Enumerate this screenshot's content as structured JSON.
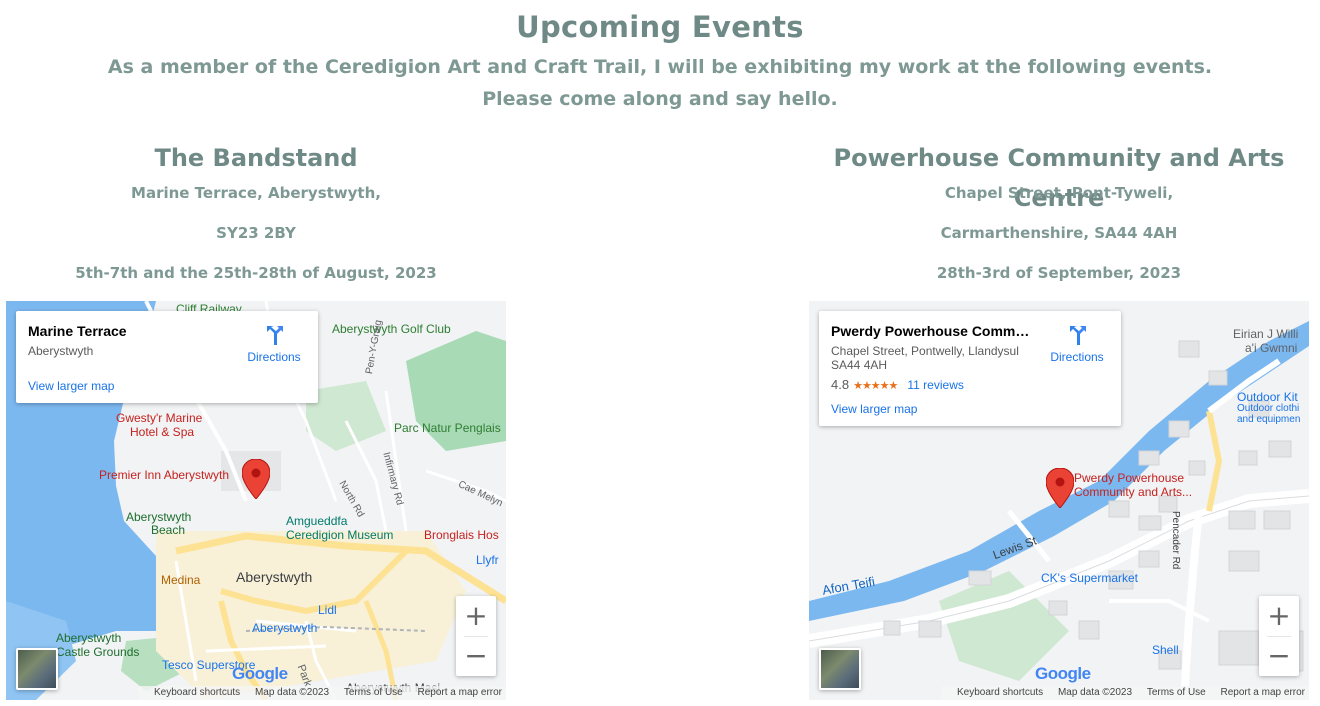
{
  "header": {
    "title": "Upcoming Events",
    "intro_line1": "As a member of the Ceredigion Art and Craft Trail, I will be exhibiting my work at the following events.",
    "intro_line2": "Please come along and say hello."
  },
  "events": [
    {
      "venue": "The Bandstand",
      "address_line1": "Marine Terrace, Aberystwyth,",
      "address_line2": "SY23 2BY",
      "dates": "5th-7th and the 25th-28th of August, 2023",
      "map": {
        "place_name": "Marine Terrace",
        "place_address": "Aberystwyth",
        "directions_label": "Directions",
        "larger_map_label": "View larger map",
        "labels": {
          "railway": "Cliff Railway",
          "golf": "Aberystwyth Golf Club",
          "hotel": "Gwesty'r Marine Hotel & Spa",
          "hotel_line1": "Gwesty'r Marine",
          "hotel_line2": "Hotel & Spa",
          "premier": "Premier Inn Aberystwyth",
          "beach_line1": "Aberystwyth",
          "beach_line2": "Beach",
          "museum_line1": "Amgueddfa",
          "museum_line2": "Ceredigion Museum",
          "town": "Aberystwyth",
          "medina": "Medina",
          "lidl": "Lidl",
          "station": "Aberystwyth",
          "castle_line1": "Aberystwyth",
          "castle_line2": "Castle Grounds",
          "tesco": "Tesco Superstore",
          "park": "Parc Natur Penglais",
          "bronglais": "Bronglais Hos",
          "llyfrgell": "Llyfr",
          "mosque": "Aberystwyth Masj",
          "pen_y_graig": "Pen-Y-Graig",
          "infirmary": "Infirmary Rd",
          "north_rd": "North Rd",
          "cae_melyn": "Cae Melyn",
          "park_rd": "Park"
        },
        "footer": {
          "shortcuts": "Keyboard shortcuts",
          "map_data": "Map data ©2023",
          "terms": "Terms of Use",
          "report": "Report a map error"
        },
        "google": "Google"
      }
    },
    {
      "venue": "Powerhouse Community and Arts Centre",
      "address_line1": "Chapel Street, Pont-Tyweli,",
      "address_line2": "Carmarthenshire, SA44 4AH",
      "dates": "28th-3rd of September, 2023",
      "map": {
        "place_name": "Pwerdy Powerhouse Community and Arts Centre",
        "place_address": "Chapel Street, Pontwelly, Llandysul SA44 4AH",
        "rating": "4.8",
        "stars": "★★★★★",
        "reviews": "11 reviews",
        "directions_label": "Directions",
        "larger_map_label": "View larger map",
        "labels": {
          "marker_line1": "Pwerdy Powerhouse",
          "marker_line2": "Community and Arts...",
          "lewis": "Lewis St",
          "afon": "Afon Teifi",
          "ck": "CK's Supermarket",
          "pencader": "Pencader Rd",
          "shell": "Shell",
          "eirian_line1": "Eirian J Willi",
          "eirian_line2": "a'i Gwmni",
          "outdoor_line1": "Outdoor Kit",
          "outdoor_line2": "Outdoor clothi",
          "outdoor_line3": "and equipmen"
        },
        "footer": {
          "shortcuts": "Keyboard shortcuts",
          "map_data": "Map data ©2023",
          "terms": "Terms of Use",
          "report": "Report a map error"
        },
        "google": "Google"
      }
    }
  ],
  "colors": {
    "heading": "#6f8a86",
    "link": "#1a73e8",
    "marker": "#ea4335",
    "water": "#7cb8f0",
    "road_major": "#fde293"
  },
  "icons": {
    "directions": "directions-icon",
    "marker": "map-marker-icon",
    "zoom_in": "plus-icon",
    "zoom_out": "minus-icon"
  }
}
